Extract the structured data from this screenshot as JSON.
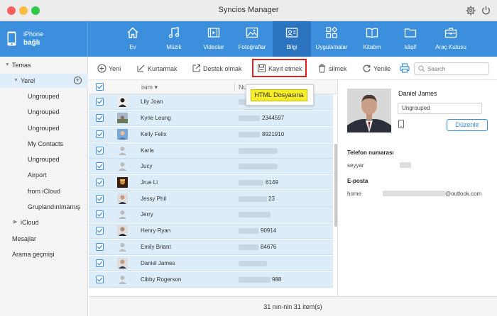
{
  "window": {
    "title": "Syncios Manager"
  },
  "device": {
    "name": "iPhone",
    "status": "bağlı"
  },
  "nav": [
    {
      "label": "Ev",
      "icon": "home-icon"
    },
    {
      "label": "Müzik",
      "icon": "music-icon"
    },
    {
      "label": "Videolar",
      "icon": "video-icon"
    },
    {
      "label": "Fotoğraflar",
      "icon": "photo-icon"
    },
    {
      "label": "Bilgi",
      "icon": "contact-card-icon",
      "active": true
    },
    {
      "label": "Uygulamalar",
      "icon": "apps-icon"
    },
    {
      "label": "Kitabın",
      "icon": "book-icon"
    },
    {
      "label": "kâşif",
      "icon": "folder-icon"
    },
    {
      "label": "Araç Kutusu",
      "icon": "toolbox-icon"
    }
  ],
  "sidebar": {
    "groups_title": "Temas",
    "local": "Yerel",
    "items": [
      "Ungrouped",
      "Ungrouped",
      "Ungrouped",
      "My Contacts",
      "Ungrouped",
      "Airport",
      "from iCloud",
      "Gruplandırılmamış"
    ],
    "icloud": "iCloud",
    "messages": "Mesajlar",
    "call_history": "Arama geçmişi"
  },
  "actions": {
    "new": "Yeni",
    "recover": "Kurtarmak",
    "backup": "Destek olmak",
    "save": "Kayıt etmek",
    "delete": "silmek",
    "refresh": "Yenile"
  },
  "search": {
    "placeholder": "Search"
  },
  "dropdown": {
    "html_item": "HTML Dosyasına"
  },
  "list": {
    "col_name": "isim",
    "col_number": "Nu",
    "rows": [
      {
        "name": "Lily Joan",
        "phone": "",
        "avatar": "avatar-icon"
      },
      {
        "name": "Kyrie Leung",
        "phone": "2344597",
        "avatar": "avatar-icon"
      },
      {
        "name": "Kelly Felix",
        "phone": "8921910",
        "avatar": "avatar-icon"
      },
      {
        "name": "Karla",
        "phone": "",
        "avatar": "avatar-icon"
      },
      {
        "name": "Jucy",
        "phone": "",
        "avatar": "avatar-icon"
      },
      {
        "name": "Jrue Li",
        "phone": "6149",
        "avatar": "avatar-icon"
      },
      {
        "name": "Jessy Phil",
        "phone": "23",
        "avatar": "avatar-icon"
      },
      {
        "name": "Jerry",
        "phone": "",
        "avatar": "avatar-icon"
      },
      {
        "name": "Henry Ryan",
        "phone": "90914",
        "avatar": "avatar-icon"
      },
      {
        "name": "Emily Briant",
        "phone": "84676",
        "avatar": "avatar-icon"
      },
      {
        "name": "Daniel James",
        "phone": "",
        "avatar": "avatar-icon"
      },
      {
        "name": "Cibby Rogerson",
        "phone": "988",
        "avatar": "avatar-icon"
      }
    ]
  },
  "footer": {
    "count": "31 nın-nin 31 item(s)"
  },
  "detail": {
    "name": "Daniel James",
    "group": "Ungrouped",
    "edit": "Düzenle",
    "phone_section": "Telefon numarası",
    "phone_label": "seyyar",
    "email_section": "E-posta",
    "email_label": "home",
    "email_domain": "@outlook.com"
  },
  "colors": {
    "accent": "#3c8fdd",
    "row_selected": "#dcecf9",
    "highlight": "#f6ec28",
    "annotation": "#e02020"
  }
}
